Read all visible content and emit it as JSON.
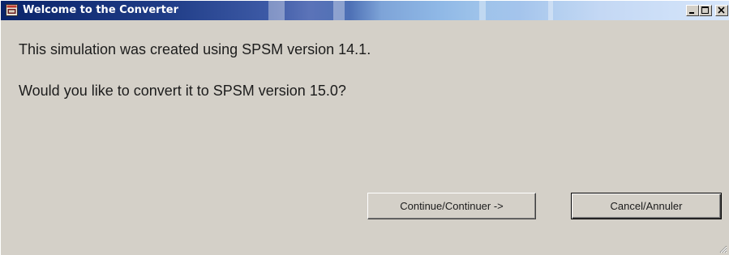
{
  "window": {
    "title": "Welcome to the Converter"
  },
  "titlebar_buttons": {
    "minimize": "minimize-icon",
    "maximize": "maximize-icon",
    "close": "close-icon"
  },
  "message": {
    "line1": "This simulation was created using SPSM version 14.1.",
    "line2": "Would you like to convert it to SPSM version 15.0?"
  },
  "buttons": {
    "continue_label": "Continue/Continuer ->",
    "cancel_label": "Cancel/Annuler"
  },
  "colors": {
    "title_active": "#0a246a",
    "face": "#d4d0c8",
    "text": "#1c1c1c"
  }
}
